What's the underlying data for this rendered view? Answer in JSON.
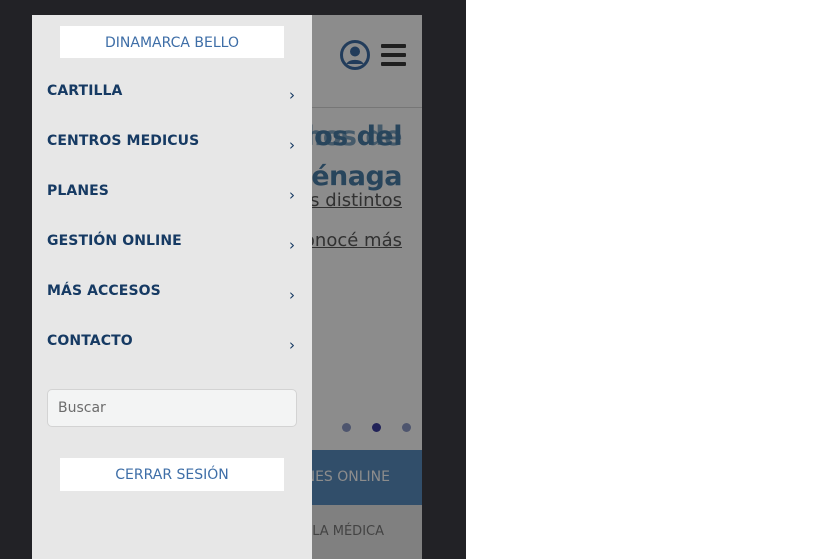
{
  "drawer": {
    "top_button": "DINAMARCA BELLO",
    "items": [
      {
        "label": "CARTILLA",
        "chevron": "›"
      },
      {
        "label": "CENTROS MEDICUS",
        "chevron": "›"
      },
      {
        "label": "PLANES",
        "chevron": "›"
      },
      {
        "label": "GESTIÓN ONLINE",
        "chevron": "›"
      },
      {
        "label": "MÁS ACCESOS",
        "chevron": "›"
      },
      {
        "label": "CONTACTO",
        "chevron": "›"
      }
    ],
    "search_placeholder": "Buscar",
    "logout_button": "CERRAR SESIÓN"
  },
  "site": {
    "hero_title_line1": "los del",
    "hero_title_line1_ghost": "nos de",
    "hero_title_line2": "uénaga",
    "hero_link1": "s distintos",
    "hero_link2": "onocé más",
    "bar_blue_text": "NES ONLINE",
    "bar_grey_text": "LA MÉDICA",
    "header_icons": [
      "user-circle-icon",
      "hamburger-menu-icon"
    ],
    "carousel_active_index": 1
  },
  "colors": {
    "drawer_bg": "#e7e7e7",
    "nav_text": "#163a63",
    "button_text": "#3e6ea7",
    "overlay": "rgba(0,0,0,0.45)",
    "brand_blue": "#5a8ec2"
  }
}
